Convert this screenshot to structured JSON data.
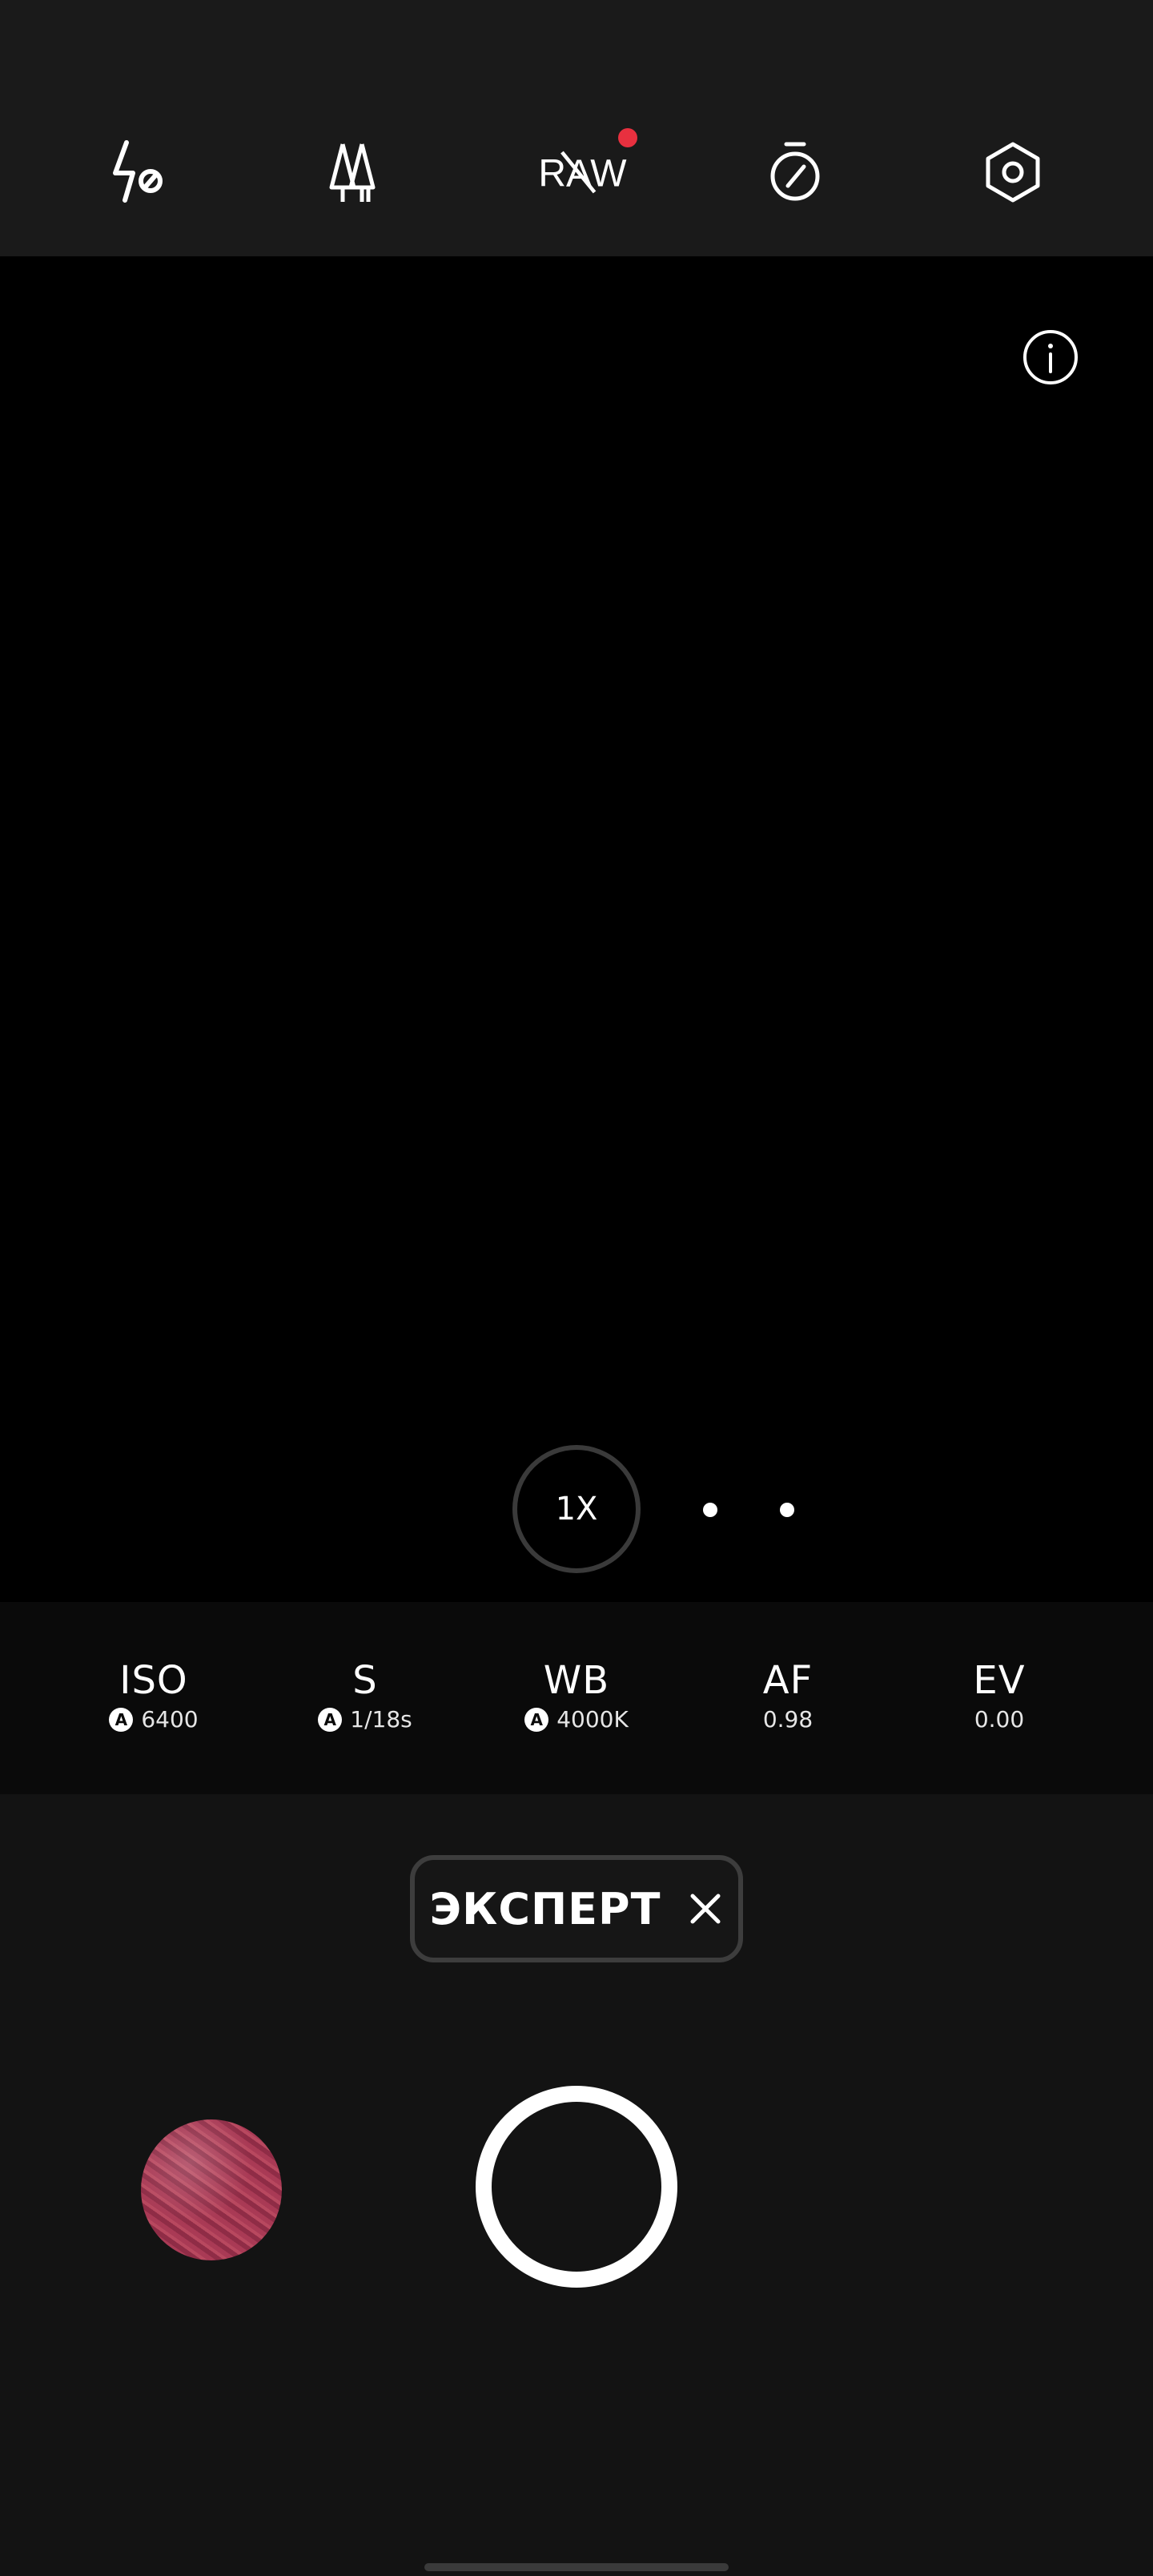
{
  "toolbar": {
    "items": [
      {
        "icon": "flash-off-icon"
      },
      {
        "icon": "tree-filter-icon"
      },
      {
        "icon": "raw-off-icon",
        "label": "RAW",
        "badge_color": "#e8303f"
      },
      {
        "icon": "timer-off-icon"
      },
      {
        "icon": "settings-icon"
      }
    ]
  },
  "viewfinder": {
    "info_icon": "info-icon",
    "zoom_label": "1X"
  },
  "pro": {
    "iso": {
      "label": "ISO",
      "auto": "A",
      "value": "6400"
    },
    "shutter": {
      "label": "S",
      "auto": "A",
      "value": "1/18s"
    },
    "wb": {
      "label": "WB",
      "auto": "A",
      "value": "4000K"
    },
    "af": {
      "label": "AF",
      "value": "0.98"
    },
    "ev": {
      "label": "EV",
      "value": "0.00"
    }
  },
  "mode": {
    "label": "ЭКСПЕРТ",
    "close_icon": "close-icon"
  },
  "capture": {
    "thumbnail": "gallery-thumbnail",
    "shutter": "shutter-button"
  }
}
